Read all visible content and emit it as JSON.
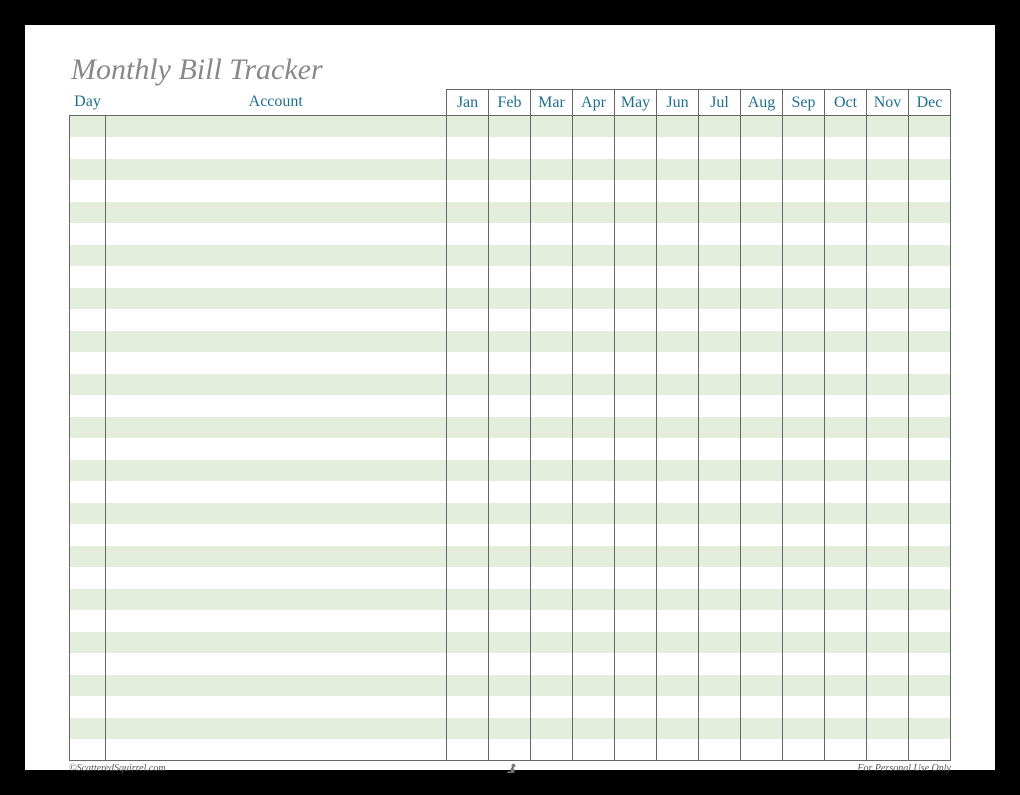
{
  "title": "Monthly Bill Tracker",
  "headers": {
    "day": "Day",
    "account": "Account"
  },
  "months": [
    "Jan",
    "Feb",
    "Mar",
    "Apr",
    "May",
    "Jun",
    "Jul",
    "Aug",
    "Sep",
    "Oct",
    "Nov",
    "Dec"
  ],
  "row_count": 30,
  "footer": {
    "copyright": "©ScatteredSquirrel.com",
    "usage": "For Personal Use Only"
  }
}
